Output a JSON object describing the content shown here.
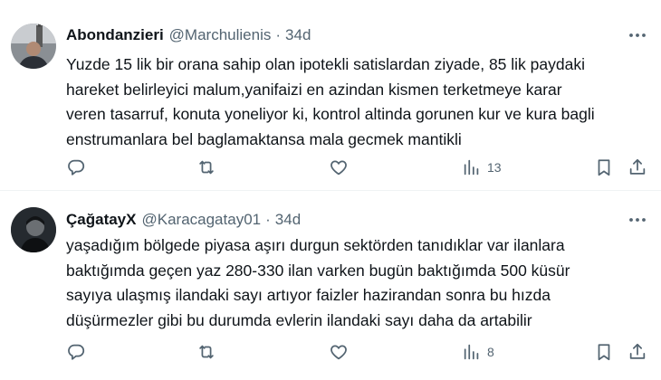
{
  "tweets": [
    {
      "name": "Abondanzieri",
      "handle": "@Marchulienis",
      "separator": "·",
      "time": "34d",
      "lines": [
        "Yuzde 15 lik bir orana sahip olan ipotekli satislardan ziyade, 85 lik paydaki",
        "hareket belirleyici malum,yanifaizi en azindan kismen terketmeye karar",
        "veren tasarruf, konuta yoneliyor ki, kontrol altinda gorunen kur ve kura bagli",
        "enstrumanlara bel baglamaktansa mala gecmek mantikli"
      ],
      "views": "13"
    },
    {
      "name": "ÇağatayX",
      "handle": "@Karacagatay01",
      "separator": "·",
      "time": "34d",
      "lines": [
        "yaşadığım bölgede piyasa aşırı durgun sektörden tanıdıklar var ilanlara",
        "baktığımda geçen yaz 280-330 ilan varken bugün baktığımda 500 küsür",
        "sayıya ulaşmış ilandaki sayı artıyor faizler hazirandan sonra bu hızda",
        "düşürmezler gibi bu durumda evlerin ilandaki sayı daha da artabilir"
      ],
      "views": "8"
    }
  ],
  "icons": {
    "reply": "reply-icon",
    "retweet": "retweet-icon",
    "like": "heart-icon",
    "views": "views-chart-icon",
    "bookmark": "bookmark-icon",
    "share": "share-icon",
    "more": "more-dots-icon"
  },
  "colors": {
    "text": "#0f1419",
    "secondary": "#536471",
    "divider": "#eff3f4"
  }
}
